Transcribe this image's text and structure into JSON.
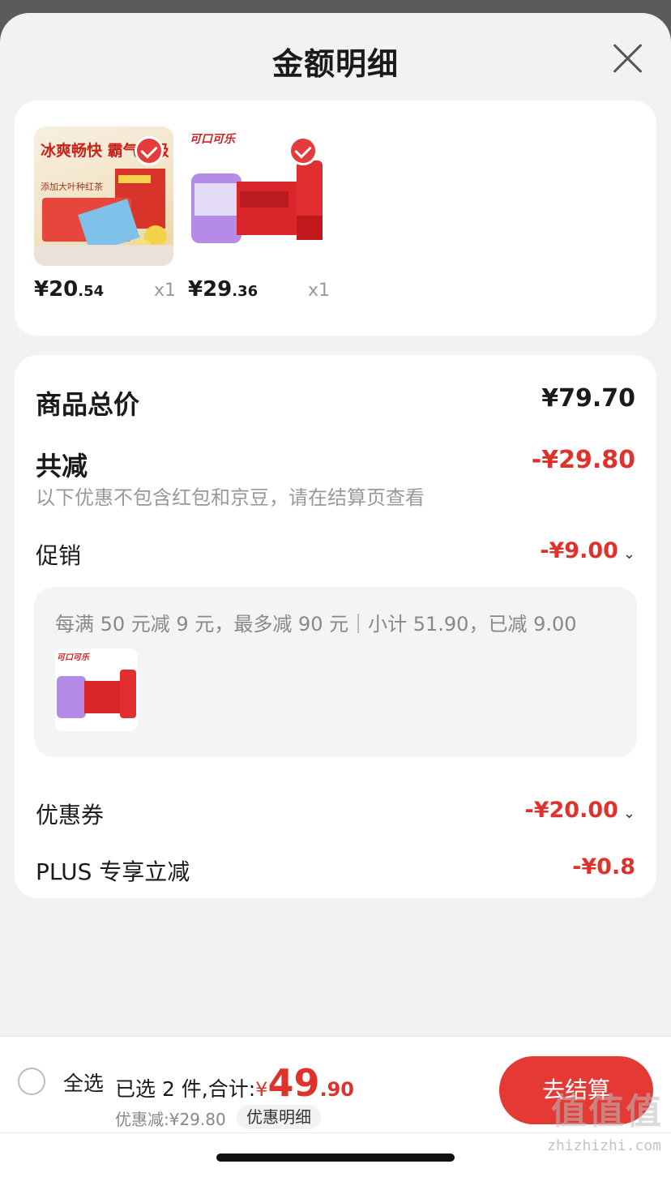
{
  "header": {
    "title": "金额明细"
  },
  "products": [
    {
      "price_int": "¥20",
      "price_dec": ".54",
      "qty": "x1",
      "image_text": "冰爽畅快 霸气升级",
      "image_sub": "添加大叶种红茶"
    },
    {
      "price_int": "¥29",
      "price_dec": ".36",
      "qty": "x1",
      "image_text": "可口可乐",
      "image_sub": ""
    }
  ],
  "detail": {
    "total_label": "商品总价",
    "total_value": "¥79.70",
    "reduce_label": "共减",
    "reduce_value": "-¥29.80",
    "note": "以下优惠不包含红包和京豆，请在结算页查看",
    "promo_label": "促销",
    "promo_value": "-¥9.00",
    "promo_desc": "每满 50 元减 9 元，最多减 90 元｜小计 51.90，已减 9.00",
    "promo_thumb_text": "可口可乐",
    "coupon_label": "优惠券",
    "coupon_value": "-¥20.00",
    "plus_label": "PLUS 专享立减",
    "plus_value": "-¥0.8"
  },
  "footer": {
    "select_all": "全选",
    "summary_prefix": "已选 2 件,合计:",
    "total_currency": "¥",
    "total_int": "49",
    "total_dec": ".90",
    "saved": "优惠减:¥29.80",
    "detail_button": "优惠明细",
    "checkout_button": "去结算",
    "watermark": "值值值",
    "watermark_url": "zhizhizhi.com"
  },
  "colors": {
    "accent": "#e53935",
    "discount": "#e0322d"
  }
}
